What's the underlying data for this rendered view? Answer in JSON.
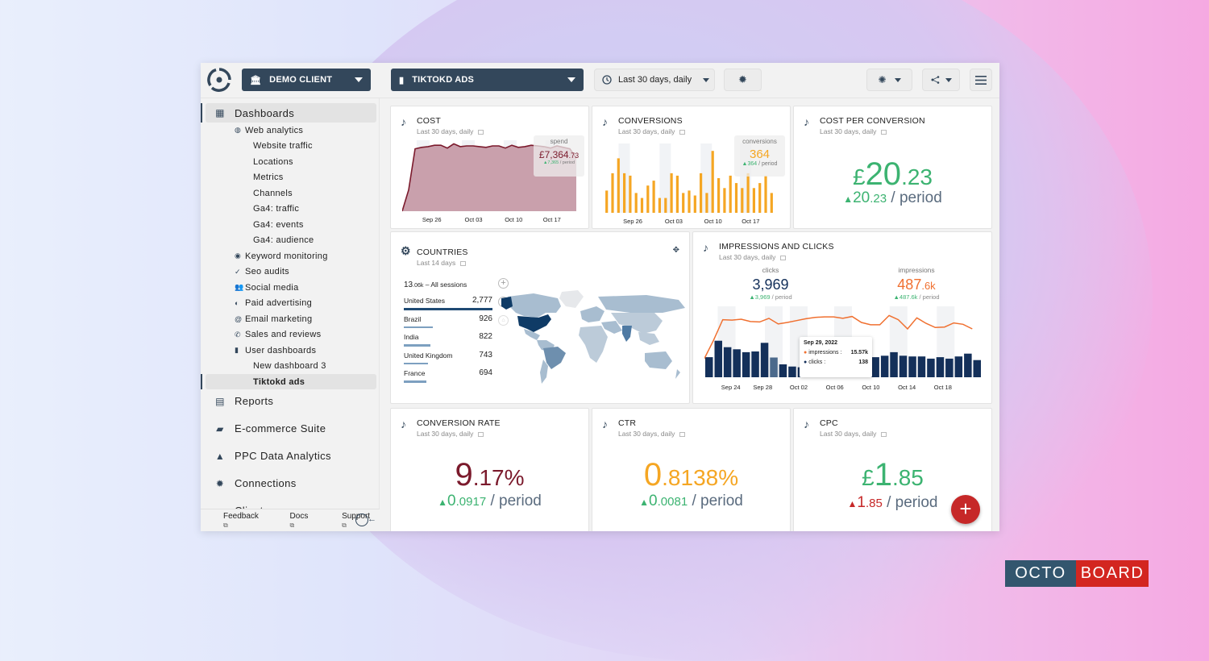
{
  "header": {
    "client_selector": "DEMO CLIENT",
    "dashboard_selector": "TIKTOKD ADS",
    "date_range": "Last 30 days, daily"
  },
  "sidebar": {
    "items": [
      {
        "label": "Dashboards",
        "level": 0,
        "icon": "dashboard-icon",
        "active": true
      },
      {
        "label": "Web analytics",
        "level": 1,
        "icon": "globe-icon"
      },
      {
        "label": "Website traffic",
        "level": 2
      },
      {
        "label": "Locations",
        "level": 2
      },
      {
        "label": "Metrics",
        "level": 2
      },
      {
        "label": "Channels",
        "level": 2
      },
      {
        "label": "Ga4: traffic",
        "level": 2
      },
      {
        "label": "Ga4: events",
        "level": 2
      },
      {
        "label": "Ga4: audience",
        "level": 2
      },
      {
        "label": "Keyword monitoring",
        "level": 1,
        "icon": "bulb-icon"
      },
      {
        "label": "Seo audits",
        "level": 1,
        "icon": "check-icon"
      },
      {
        "label": "Social media",
        "level": 1,
        "icon": "people-icon"
      },
      {
        "label": "Paid advertising",
        "level": 1,
        "icon": "coin-icon"
      },
      {
        "label": "Email marketing",
        "level": 1,
        "icon": "at-icon"
      },
      {
        "label": "Sales and reviews",
        "level": 1,
        "icon": "phone-icon"
      },
      {
        "label": "User dashboards",
        "level": 1,
        "icon": "file-icon"
      },
      {
        "label": "New dashboard 3",
        "level": 2
      },
      {
        "label": "Tiktokd ads",
        "level": 2,
        "active": true
      },
      {
        "label": "Reports",
        "level": 0,
        "icon": "clipboard-icon"
      },
      {
        "label": "E-commerce Suite",
        "level": 0,
        "icon": "bag-icon"
      },
      {
        "label": "PPC Data Analytics",
        "level": 0,
        "icon": "ads-icon"
      },
      {
        "label": "Connections",
        "level": 0,
        "icon": "plug-icon"
      },
      {
        "label": "Clients",
        "level": 0,
        "icon": "client-icon"
      }
    ],
    "footer": {
      "feedback": "Feedback",
      "docs": "Docs",
      "support": "Support"
    }
  },
  "cards": {
    "cost": {
      "title": "COST",
      "subtitle": "Last 30 days, daily",
      "overlay_label": "spend",
      "overlay_value_main": "£7,364",
      "overlay_value_dec": ".73",
      "overlay_delta": "▲7,365",
      "overlay_period": " / period",
      "x_ticks": [
        "Sep 26",
        "Oct 03",
        "Oct 10",
        "Oct 17"
      ]
    },
    "conversions": {
      "title": "CONVERSIONS",
      "subtitle": "Last 30 days, daily",
      "overlay_label": "conversions",
      "overlay_value": "364",
      "overlay_delta": "▲364",
      "overlay_period": " / period",
      "x_ticks": [
        "Sep 26",
        "Oct 03",
        "Oct 10",
        "Oct 17"
      ]
    },
    "cost_per_conversion": {
      "title": "COST PER CONVERSION",
      "subtitle": "Last 30 days, daily",
      "currency": "£",
      "value_main": "20",
      "value_dec": ".23",
      "delta_main": "20",
      "delta_dec": ".23",
      "period": " / period",
      "trend": "up"
    },
    "countries": {
      "title": "COUNTRIES",
      "subtitle": "Last 14 days",
      "total_main": "13",
      "total_dec": ".06k",
      "total_label": " – All sessions",
      "rows": [
        {
          "country": "United States",
          "value": "2,777",
          "share": 1.0
        },
        {
          "country": "Brazil",
          "value": "926",
          "share": 0.33
        },
        {
          "country": "India",
          "value": "822",
          "share": 0.3
        },
        {
          "country": "United Kingdom",
          "value": "743",
          "share": 0.27
        },
        {
          "country": "France",
          "value": "694",
          "share": 0.25
        }
      ]
    },
    "impressions_clicks": {
      "title": "IMPRESSIONS AND CLICKS",
      "subtitle": "Last 30 days, daily",
      "clicks_label": "clicks",
      "clicks_value": "3,969",
      "clicks_delta": "▲3,969",
      "clicks_period": " / period",
      "impr_label": "impressions",
      "impr_value_main": "487",
      "impr_value_dec": ".6k",
      "impr_delta": "▲487.6k",
      "impr_period": " / period",
      "tooltip": {
        "date": "Sep 29, 2022",
        "impr_label": "impressions :",
        "impr_value": "15.57k",
        "clicks_label": "clicks :",
        "clicks_value": "138"
      },
      "x_ticks": [
        "Sep 24",
        "Sep 28",
        "Oct 02",
        "Oct 06",
        "Oct 10",
        "Oct 14",
        "Oct 18"
      ]
    },
    "conversion_rate": {
      "title": "CONVERSION RATE",
      "subtitle": "Last 30 days, daily",
      "value_main": "9",
      "value_dec": ".17%",
      "delta_main": "0",
      "delta_dec": ".0917",
      "period": " / period",
      "trend": "up"
    },
    "ctr": {
      "title": "CTR",
      "subtitle": "Last 30 days, daily",
      "value_main": "0",
      "value_dec": ".8138%",
      "delta_main": "0",
      "delta_dec": ".0081",
      "period": " / period",
      "trend": "up"
    },
    "cpc": {
      "title": "CPC",
      "subtitle": "Last 30 days, daily",
      "currency": "£",
      "value_main": "1",
      "value_dec": ".85",
      "delta_main": "1",
      "delta_dec": ".85",
      "period": " / period",
      "trend": "up-bad"
    }
  },
  "colors": {
    "primary": "#33475b",
    "cost": "#7b1a2c",
    "conversions": "#f5a623",
    "positive": "#3cb371",
    "negative": "#c62828",
    "impressions": "#f07030",
    "clicks": "#14305a"
  },
  "chart_data": [
    {
      "type": "area",
      "title": "COST",
      "xlabel": "",
      "ylabel": "spend",
      "x_ticks": [
        "Sep 26",
        "Oct 03",
        "Oct 10",
        "Oct 17"
      ],
      "values": [
        0,
        30,
        88,
        90,
        91,
        93,
        93,
        89,
        95,
        91,
        92,
        92,
        91,
        90,
        92,
        92,
        89,
        93,
        90,
        91,
        93,
        92,
        91,
        89,
        92,
        90,
        88,
        75
      ]
    },
    {
      "type": "bar",
      "title": "CONVERSIONS",
      "xlabel": "",
      "ylabel": "conversions",
      "x_ticks": [
        "Sep 26",
        "Oct 03",
        "Oct 10",
        "Oct 17"
      ],
      "values": [
        9,
        16,
        22,
        16,
        15,
        8,
        6,
        11,
        13,
        6,
        6,
        16,
        15,
        8,
        9,
        7,
        16,
        8,
        25,
        14,
        10,
        15,
        12,
        10,
        16,
        10,
        12,
        15,
        8
      ]
    },
    {
      "type": "line+bar",
      "title": "IMPRESSIONS AND CLICKS",
      "x_ticks": [
        "Sep 24",
        "Sep 28",
        "Oct 02",
        "Oct 06",
        "Oct 10",
        "Oct 14",
        "Oct 18"
      ],
      "series": [
        {
          "name": "impressions",
          "type": "line",
          "values": [
            8,
            12,
            16.5,
            16.4,
            16.6,
            16.1,
            16.0,
            16.8,
            15.57,
            15.9,
            16.3,
            16.7,
            17.0,
            17.1,
            17.1,
            16.8,
            17.2,
            15.9,
            15.4,
            15.4,
            17.4,
            16.5,
            14.5,
            16.9,
            15.7,
            14.8,
            14.9,
            15.8,
            15.5,
            14.5
          ]
        },
        {
          "name": "clicks",
          "type": "bar",
          "values": [
            140,
            255,
            210,
            195,
            175,
            180,
            240,
            138,
            90,
            75,
            70,
            70,
            70,
            70,
            70,
            70,
            70,
            70,
            140,
            150,
            175,
            150,
            145,
            145,
            130,
            140,
            130,
            145,
            165,
            120
          ]
        }
      ]
    }
  ]
}
